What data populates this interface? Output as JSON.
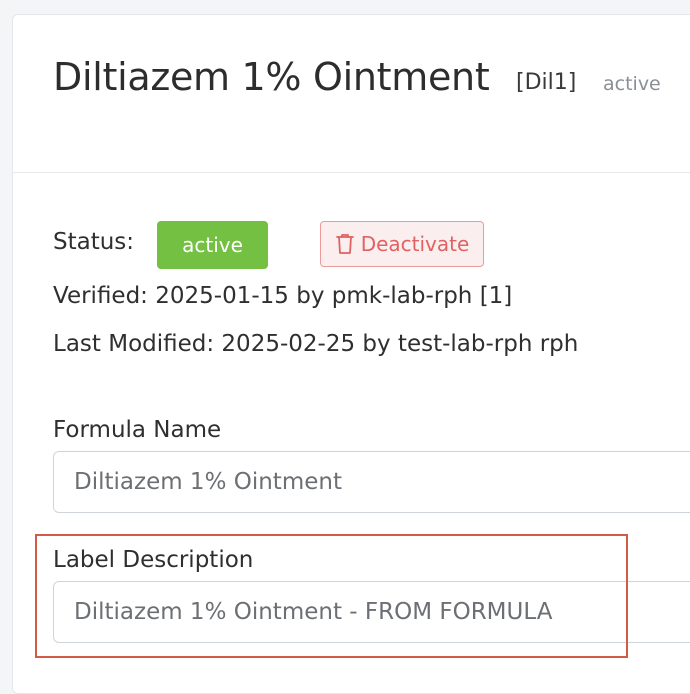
{
  "header": {
    "title": "Diltiazem 1% Ointment",
    "code": "[Dil1]",
    "status": "active"
  },
  "details": {
    "status_label": "Status:",
    "status_badge": "active",
    "deactivate_label": "Deactivate",
    "verified": "Verified: 2025-01-15 by pmk-lab-rph [1]",
    "last_modified": "Last Modified: 2025-02-25 by test-lab-rph rph"
  },
  "form": {
    "formula_name_label": "Formula Name",
    "formula_name_value": "Diltiazem 1% Ointment",
    "label_description_label": "Label Description",
    "label_description_value": "Diltiazem 1% Ointment - FROM FORMULA"
  },
  "colors": {
    "badge_active": "#74c043",
    "deactivate_text": "#e06262",
    "highlight": "#d35b46"
  },
  "icons": {
    "deactivate": "trash-icon"
  }
}
